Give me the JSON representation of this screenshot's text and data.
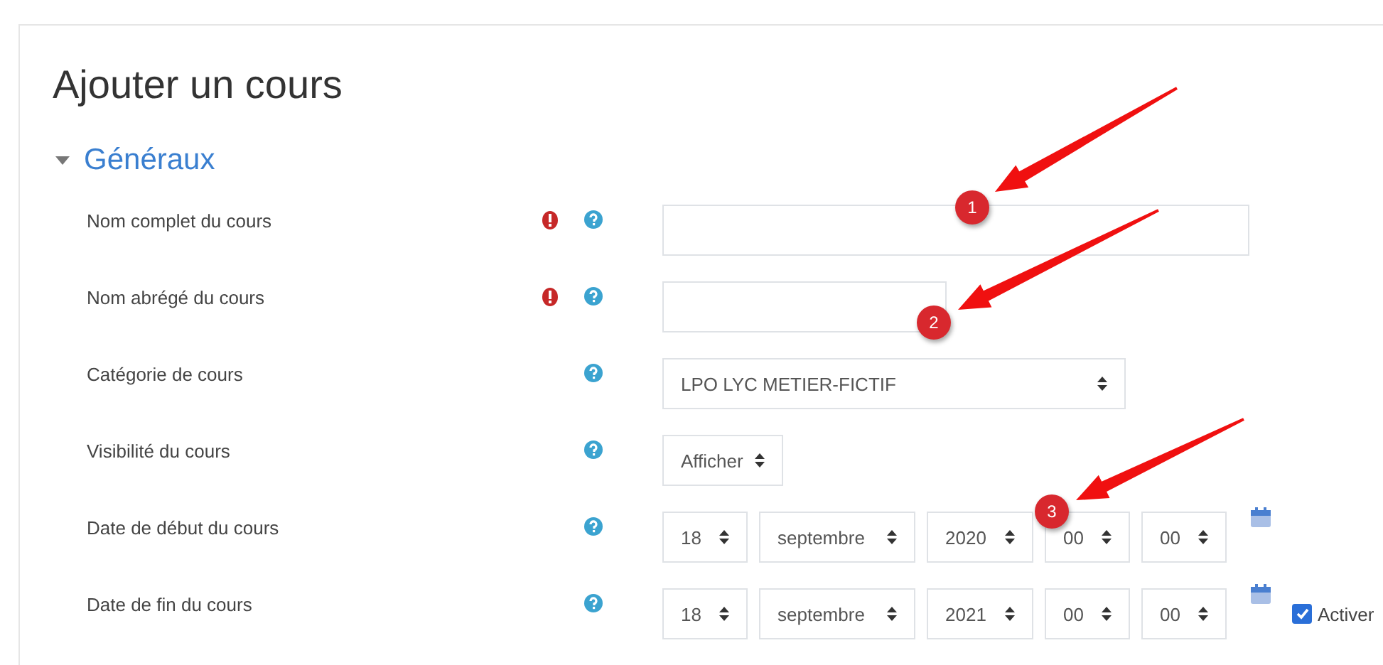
{
  "page_title": "Ajouter un cours",
  "section": {
    "title": "Généraux",
    "expanded": true
  },
  "fields": [
    {
      "label": "Nom complet du cours",
      "required": true,
      "kind": "text"
    },
    {
      "label": "Nom abrégé du cours",
      "required": true,
      "kind": "text"
    },
    {
      "label": "Catégorie de cours",
      "required": false,
      "kind": "select",
      "value": "LPO LYC METIER-FICTIF"
    },
    {
      "label": "Visibilité du cours",
      "required": false,
      "kind": "select",
      "value": "Afficher"
    },
    {
      "label": "Date de début du cours",
      "required": false,
      "kind": "date",
      "parts": [
        "18",
        "septembre",
        "2020",
        "00",
        "00"
      ]
    },
    {
      "label": "Date de fin du cours",
      "required": false,
      "kind": "date",
      "parts": [
        "18",
        "septembre",
        "2021",
        "00",
        "00"
      ],
      "enable": {
        "label": "Activer",
        "checked": true
      }
    }
  ],
  "annotations": [
    {
      "number": "1"
    },
    {
      "number": "2"
    },
    {
      "number": "3"
    }
  ]
}
